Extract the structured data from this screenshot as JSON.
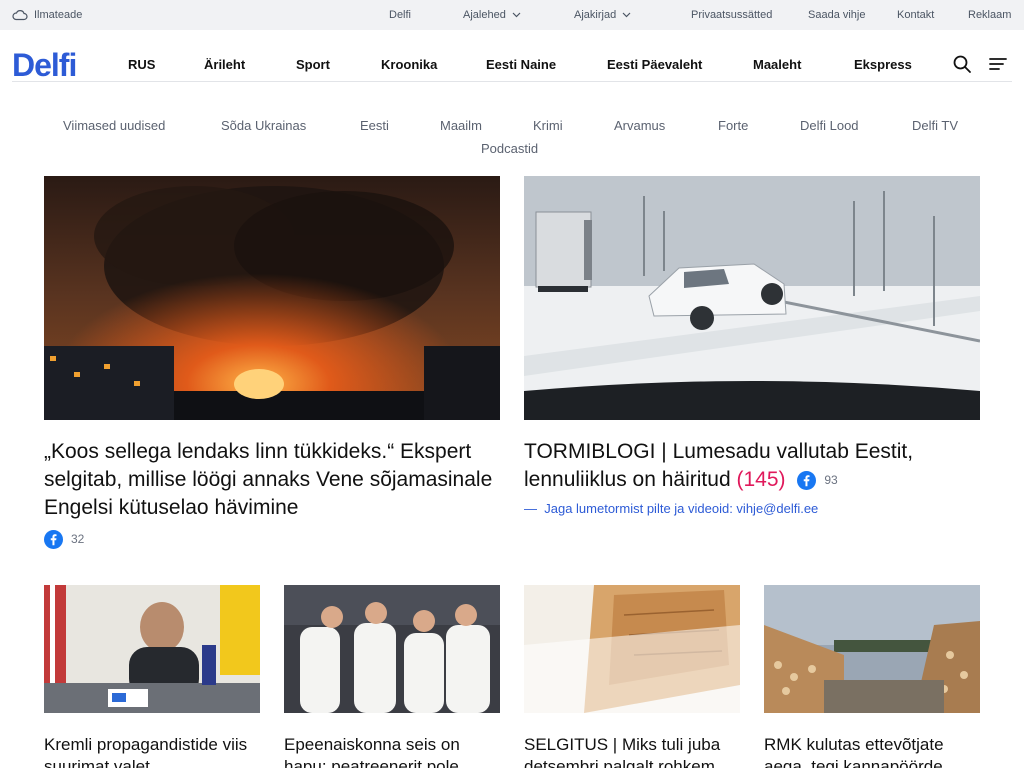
{
  "topbar": {
    "weather": "Ilmateade",
    "delfi": "Delfi",
    "newspapers": "Ajalehed",
    "magazines": "Ajakirjad",
    "privacy": "Privaatsussätted",
    "tip": "Saada vihje",
    "contact": "Kontakt",
    "ads": "Reklaam"
  },
  "header": {
    "logo": "Delfi",
    "nav": [
      "RUS",
      "Ärileht",
      "Sport",
      "Kroonika",
      "Eesti Naine",
      "Eesti Päevaleht",
      "Maaleht",
      "Ekspress"
    ]
  },
  "subnav": [
    "Viimased uudised",
    "Sõda Ukrainas",
    "Eesti",
    "Maailm",
    "Krimi",
    "Arvamus",
    "Forte",
    "Delfi Lood",
    "Delfi TV",
    "Podcastid"
  ],
  "lead": [
    {
      "title": "„Koos sellega lendaks linn tükkideks.“ Ekspert selgitab, millise löögi annaks Vene sõjamasinale Engelsi kütuselao hävimine",
      "fb_count": "32"
    },
    {
      "title": "TORMIBLOGI | Lumesadu vallutab Eestit, lennuliiklus on häiritud",
      "comments": "(145)",
      "fb_count": "93",
      "sublink": "Jaga lumetormist pilte ja videoid: vihje@delfi.ee"
    }
  ],
  "small": [
    {
      "title": "Kremli propagandistide viis suurimat valet"
    },
    {
      "title": "Epeenaiskonna seis on hapu: peatreenerit pole"
    },
    {
      "title": "SELGITUS | Miks tuli juba detsembri palgalt rohkem"
    },
    {
      "title": "RMK kulutas ettevõtjate aega, tegi kannapöörde"
    }
  ],
  "colors": {
    "brand": "#2d5bd6",
    "comments": "#e0195b",
    "facebook": "#1877f2"
  }
}
